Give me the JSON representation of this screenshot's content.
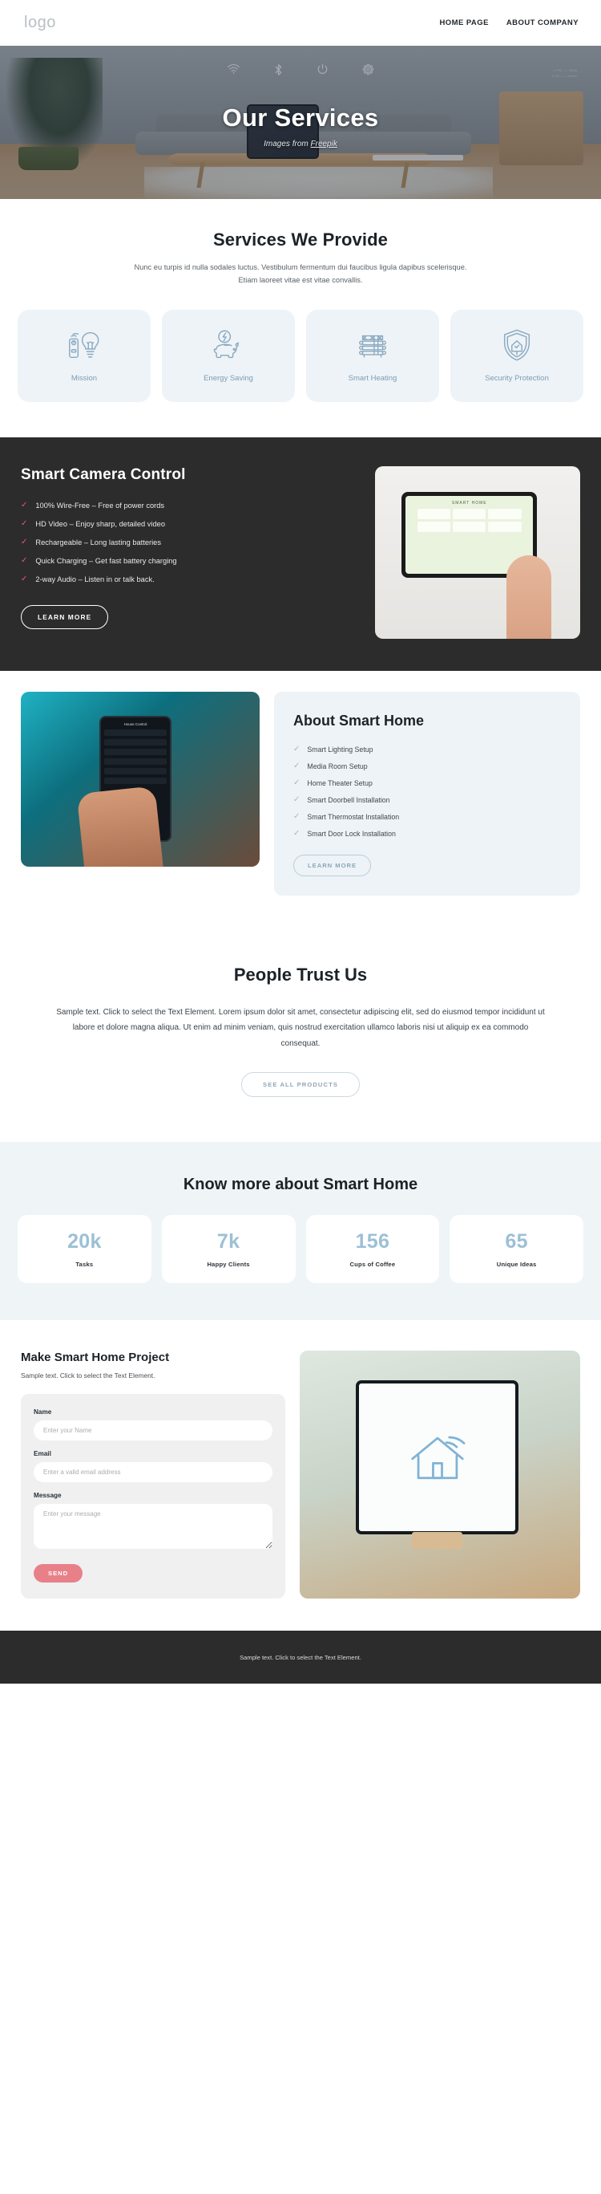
{
  "header": {
    "logo": "logo",
    "nav": [
      {
        "label": "HOME PAGE"
      },
      {
        "label": "ABOUT COMPANY"
      }
    ]
  },
  "hero": {
    "title": "Our Services",
    "credit_prefix": "Images from ",
    "credit_link": "Freepik",
    "overlay_icons": [
      "wifi-icon",
      "bluetooth-icon",
      "power-icon",
      "settings-icon"
    ],
    "clock_rows": [
      {
        "time": "2 PM",
        "label": "Work"
      },
      {
        "time": "5 PM",
        "label": "Dinner"
      }
    ]
  },
  "services": {
    "title": "Services We Provide",
    "subtitle": "Nunc eu turpis id nulla sodales luctus. Vestibulum fermentum dui faucibus ligula dapibus scelerisque. Etiam laoreet vitae est vitae convallis.",
    "cards": [
      {
        "label": "Mission",
        "icon": "lightbulb-remote-icon"
      },
      {
        "label": "Energy Saving",
        "icon": "piggy-bank-icon"
      },
      {
        "label": "Smart Heating",
        "icon": "radiator-icon"
      },
      {
        "label": "Security Protection",
        "icon": "shield-home-icon"
      }
    ]
  },
  "camera": {
    "title": "Smart Camera Control",
    "features": [
      "100% Wire-Free – Free of power cords",
      "HD Video – Enjoy sharp, detailed video",
      "Rechargeable – Long lasting batteries",
      "Quick Charging – Get fast battery charging",
      "2-way Audio – Listen in or talk back."
    ],
    "button": "LEARN MORE",
    "panel_title": "SMART HOME"
  },
  "about": {
    "title": "About Smart Home",
    "phone_header": "House Control",
    "items": [
      "Smart Lighting Setup",
      "Media Room Setup",
      "Home Theater Setup",
      "Smart Doorbell Installation",
      "Smart Thermostat Installation",
      "Smart Door Lock Installation"
    ],
    "button": "LEARN MORE"
  },
  "trust": {
    "title": "People Trust Us",
    "text": "Sample text. Click to select the Text Element. Lorem ipsum dolor sit amet, consectetur adipiscing elit, sed do eiusmod tempor incididunt ut labore et dolore magna aliqua. Ut enim ad minim veniam, quis nostrud exercitation ullamco laboris nisi ut aliquip ex ea commodo consequat.",
    "button": "SEE ALL PRODUCTS"
  },
  "stats": {
    "title": "Know more about Smart Home",
    "items": [
      {
        "value": "20k",
        "label": "Tasks"
      },
      {
        "value": "7k",
        "label": "Happy Clients"
      },
      {
        "value": "156",
        "label": "Cups of Coffee"
      },
      {
        "value": "65",
        "label": "Unique Ideas"
      }
    ]
  },
  "project": {
    "title": "Make Smart Home Project",
    "subtitle": "Sample text. Click to select the Text Element.",
    "form": {
      "name_label": "Name",
      "name_placeholder": "Enter your Name",
      "name_value": "",
      "email_label": "Email",
      "email_placeholder": "Enter a valid email address",
      "email_value": "",
      "message_label": "Message",
      "message_placeholder": "Enter your message",
      "message_value": "",
      "submit_label": "SEND"
    }
  },
  "footer": {
    "text": "Sample text. Click to select the Text Element."
  },
  "colors": {
    "dark": "#2c2c2c",
    "accent_blue": "#9cc0d6",
    "accent_red": "#e35d6a",
    "panel_light": "#eef3f7",
    "send_button": "#e8808a"
  }
}
